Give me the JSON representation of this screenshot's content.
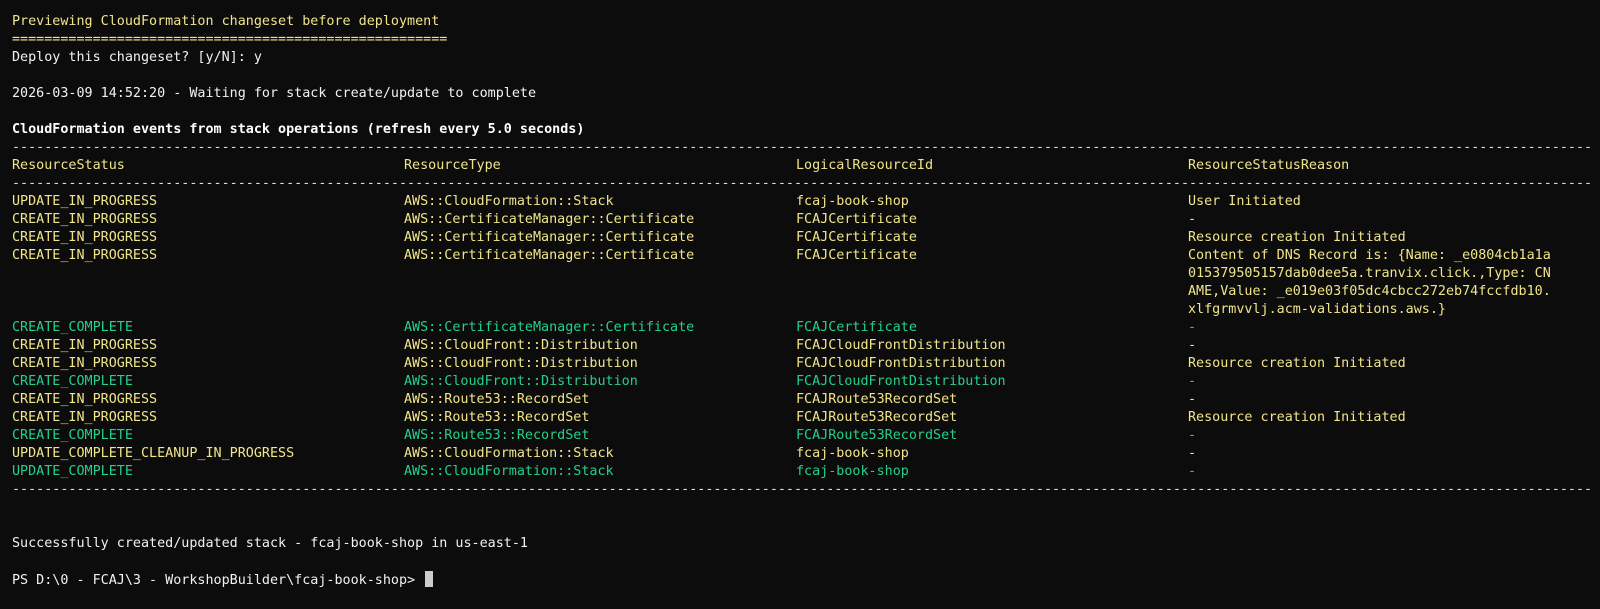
{
  "header": {
    "preview_line": "Previewing CloudFormation changeset before deployment",
    "underline": "======================================================",
    "prompt_line": "Deploy this changeset? [y/N]: y",
    "waiting_line": "2026-03-09 14:52:20 - Waiting for stack create/update to complete",
    "events_title": "CloudFormation events from stack operations (refresh every 5.0 seconds)"
  },
  "separator": "-----------------------------------------------------------------------------------------------------------------------------------------------------------------------------------------------------------------",
  "table": {
    "columns": [
      "ResourceStatus",
      "ResourceType",
      "LogicalResourceId",
      "ResourceStatusReason"
    ],
    "rows": [
      {
        "status": "UPDATE_IN_PROGRESS",
        "type": "AWS::CloudFormation::Stack",
        "id": "fcaj-book-shop",
        "reason": "User Initiated",
        "color": "yellow"
      },
      {
        "status": "CREATE_IN_PROGRESS",
        "type": "AWS::CertificateManager::Certificate",
        "id": "FCAJCertificate",
        "reason": "-",
        "color": "yellow"
      },
      {
        "status": "CREATE_IN_PROGRESS",
        "type": "AWS::CertificateManager::Certificate",
        "id": "FCAJCertificate",
        "reason": "Resource creation Initiated",
        "color": "yellow"
      },
      {
        "status": "CREATE_IN_PROGRESS",
        "type": "AWS::CertificateManager::Certificate",
        "id": "FCAJCertificate",
        "reason": "Content of DNS Record is: {Name: _e0804cb1a1a015379505157dab0dee5a.tranvix.click.,Type: CNAME,Value: _e019e03f05dc4cbcc272eb74fccfdb10.xlfgrmvvlj.acm-validations.aws.}",
        "color": "yellow"
      },
      {
        "status": "CREATE_COMPLETE",
        "type": "AWS::CertificateManager::Certificate",
        "id": "FCAJCertificate",
        "reason": "-",
        "color": "green"
      },
      {
        "status": "CREATE_IN_PROGRESS",
        "type": "AWS::CloudFront::Distribution",
        "id": "FCAJCloudFrontDistribution",
        "reason": "-",
        "color": "yellow"
      },
      {
        "status": "CREATE_IN_PROGRESS",
        "type": "AWS::CloudFront::Distribution",
        "id": "FCAJCloudFrontDistribution",
        "reason": "Resource creation Initiated",
        "color": "yellow"
      },
      {
        "status": "CREATE_COMPLETE",
        "type": "AWS::CloudFront::Distribution",
        "id": "FCAJCloudFrontDistribution",
        "reason": "-",
        "color": "green"
      },
      {
        "status": "CREATE_IN_PROGRESS",
        "type": "AWS::Route53::RecordSet",
        "id": "FCAJRoute53RecordSet",
        "reason": "-",
        "color": "yellow"
      },
      {
        "status": "CREATE_IN_PROGRESS",
        "type": "AWS::Route53::RecordSet",
        "id": "FCAJRoute53RecordSet",
        "reason": "Resource creation Initiated",
        "color": "yellow"
      },
      {
        "status": "CREATE_COMPLETE",
        "type": "AWS::Route53::RecordSet",
        "id": "FCAJRoute53RecordSet",
        "reason": "-",
        "color": "green"
      },
      {
        "status": "UPDATE_COMPLETE_CLEANUP_IN_PROGRESS",
        "type": "AWS::CloudFormation::Stack",
        "id": "fcaj-book-shop",
        "reason": "-",
        "color": "yellow"
      },
      {
        "status": "UPDATE_COMPLETE",
        "type": "AWS::CloudFormation::Stack",
        "id": "fcaj-book-shop",
        "reason": "-",
        "color": "green"
      }
    ]
  },
  "footer": {
    "success_line": "Successfully created/updated stack - fcaj-book-shop in us-east-1",
    "prompt": "PS D:\\0 - FCAJ\\3 - WorkshopBuilder\\fcaj-book-shop>"
  },
  "colors": {
    "background": "#0c0c0c",
    "yellow": "#f1e58a",
    "green": "#23d18b",
    "default_text": "#cccccc"
  }
}
